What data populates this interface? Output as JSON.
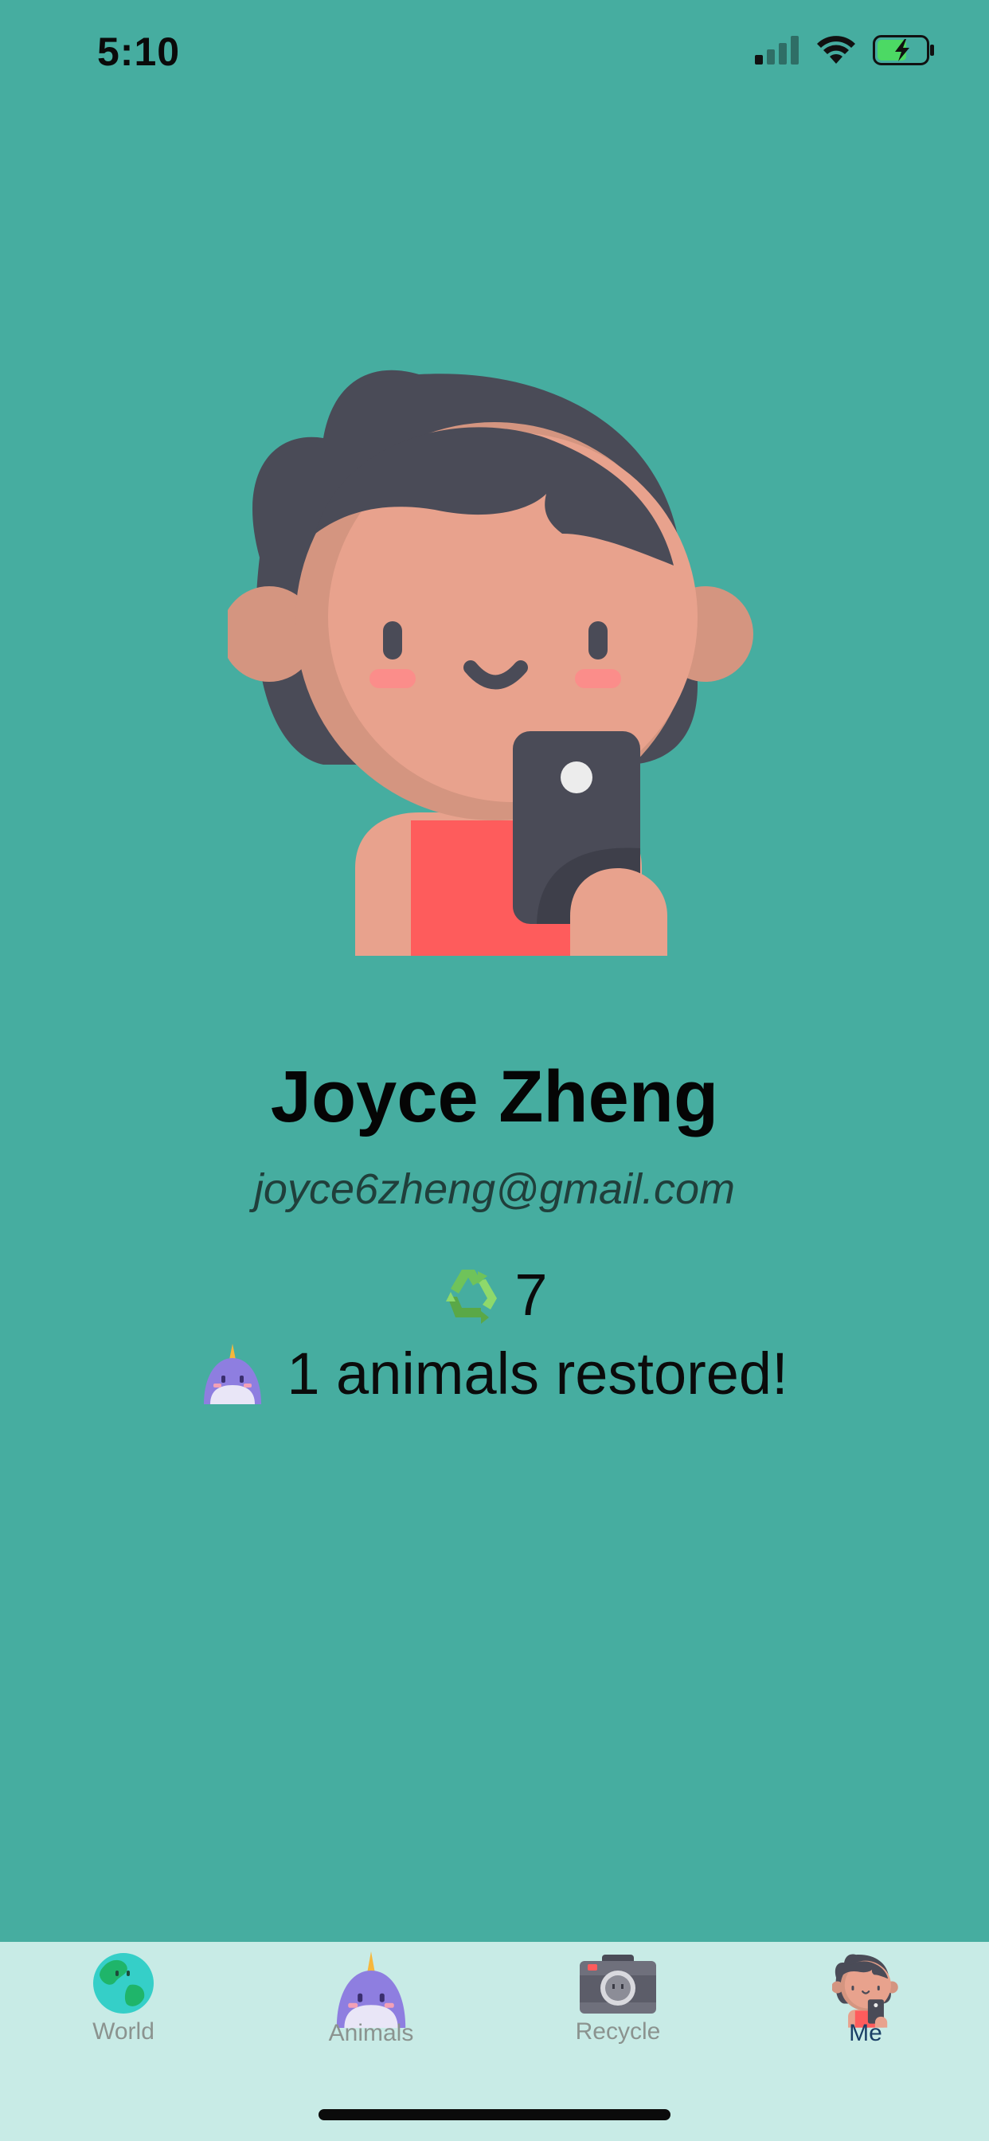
{
  "status_bar": {
    "time": "5:10"
  },
  "profile": {
    "name": "Joyce Zheng",
    "email": "joyce6zheng@gmail.com",
    "recycle_count": "7",
    "animals_text": "1 animals restored!"
  },
  "tabs": [
    {
      "label": "World",
      "icon": "globe-icon",
      "active": false
    },
    {
      "label": "Animals",
      "icon": "narwhal-icon",
      "active": false
    },
    {
      "label": "Recycle",
      "icon": "camera-icon",
      "active": false
    },
    {
      "label": "Me",
      "icon": "avatar-icon",
      "active": true
    }
  ],
  "colors": {
    "background": "#46ada0",
    "tab_bar": "#c8ebe6",
    "active_tab": "#1a3f66",
    "inactive_tab": "#8b938f"
  }
}
